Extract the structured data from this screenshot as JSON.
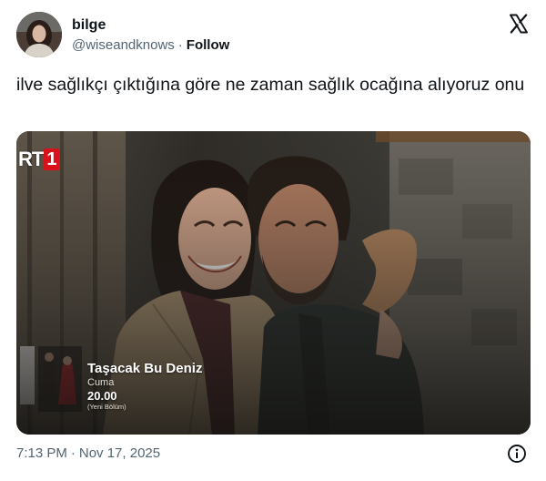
{
  "author": {
    "display_name": "bilge",
    "handle": "@wiseandknows",
    "follow_label": "Follow"
  },
  "tweet": {
    "text": "ilve sağlıkçı çıktığına göre ne zaman sağlık ocağına alıyoruz onu",
    "time": "7:13 PM",
    "date": "Nov 17, 2025"
  },
  "media": {
    "channel_logo_text": "RT",
    "channel_logo_number": "1",
    "promo_title": "Taşacak Bu Deniz",
    "promo_day": "Cuma",
    "promo_time": "20.00",
    "promo_note": "(Yeni Bölüm)"
  },
  "icons": {
    "platform_logo": "x-logo-icon",
    "info": "info-icon"
  },
  "colors": {
    "text_primary": "#0f1419",
    "text_secondary": "#536471",
    "channel_red": "#d8121b"
  }
}
